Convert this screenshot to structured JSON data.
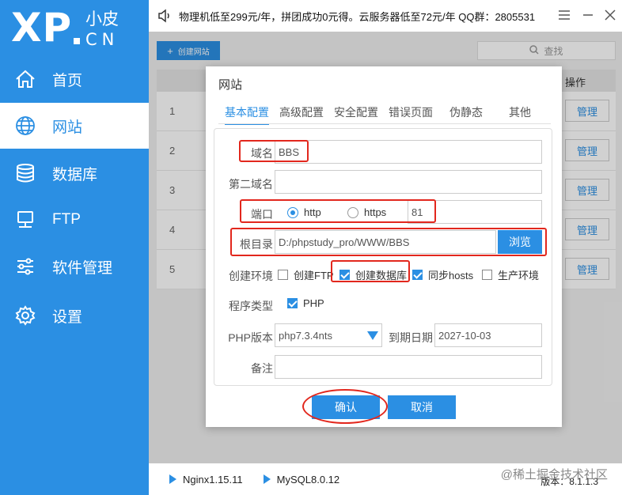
{
  "colors": {
    "brand": "#2b8fe3",
    "highlight": "#e2271d"
  },
  "logo": {
    "main": "XP",
    "cn_top": "小皮",
    "cn_bottom": "CN"
  },
  "sidebar": {
    "items": [
      {
        "label": "首页",
        "icon": "home-icon"
      },
      {
        "label": "网站",
        "icon": "globe-icon",
        "active": true
      },
      {
        "label": "数据库",
        "icon": "database-icon"
      },
      {
        "label": "FTP",
        "icon": "ftp-monitor-icon"
      },
      {
        "label": "软件管理",
        "icon": "sliders-icon"
      },
      {
        "label": "设置",
        "icon": "gear-icon"
      }
    ]
  },
  "topbar": {
    "notice": "物理机低至299元/年，拼团成功0元得。云服务器低至72元/年  QQ群：2805531"
  },
  "main": {
    "create_button": "创建网站",
    "search_placeholder": "查找",
    "table_ops_header": "操作",
    "rows": [
      {
        "num": "1",
        "action": "管理"
      },
      {
        "num": "2",
        "action": "管理"
      },
      {
        "num": "3",
        "action": "管理"
      },
      {
        "num": "4",
        "action": "管理"
      },
      {
        "num": "5",
        "action": "管理"
      }
    ]
  },
  "dialog": {
    "title": "网站",
    "tabs": [
      "基本配置",
      "高级配置",
      "安全配置",
      "错误页面",
      "伪静态",
      "其他"
    ],
    "fields": {
      "domain_label": "域名",
      "domain_value": "BBS",
      "second_domain_label": "第二域名",
      "second_domain_value": "",
      "port_label": "端口",
      "http_label": "http",
      "https_label": "https",
      "port_value": "81",
      "root_label": "根目录",
      "root_value": "D:/phpstudy_pro/WWW/BBS",
      "browse_label": "浏览",
      "env_label": "创建环境",
      "env_options": [
        {
          "label": "创建FTP",
          "checked": false
        },
        {
          "label": "创建数据库",
          "checked": true
        },
        {
          "label": "同步hosts",
          "checked": true
        },
        {
          "label": "生产环境",
          "checked": false
        }
      ],
      "program_type_label": "程序类型",
      "program_type_value": "PHP",
      "php_version_label": "PHP版本",
      "php_version_value": "php7.3.4nts",
      "expire_label": "到期日期",
      "expire_value": "2027-10-03",
      "note_label": "备注",
      "note_value": ""
    },
    "confirm_label": "确认",
    "cancel_label": "取消"
  },
  "statusbar": {
    "items": [
      "Nginx1.15.11",
      "MySQL8.0.12"
    ],
    "version": "版本：8.1.1.3",
    "watermark": "@稀土掘金技术社区"
  }
}
